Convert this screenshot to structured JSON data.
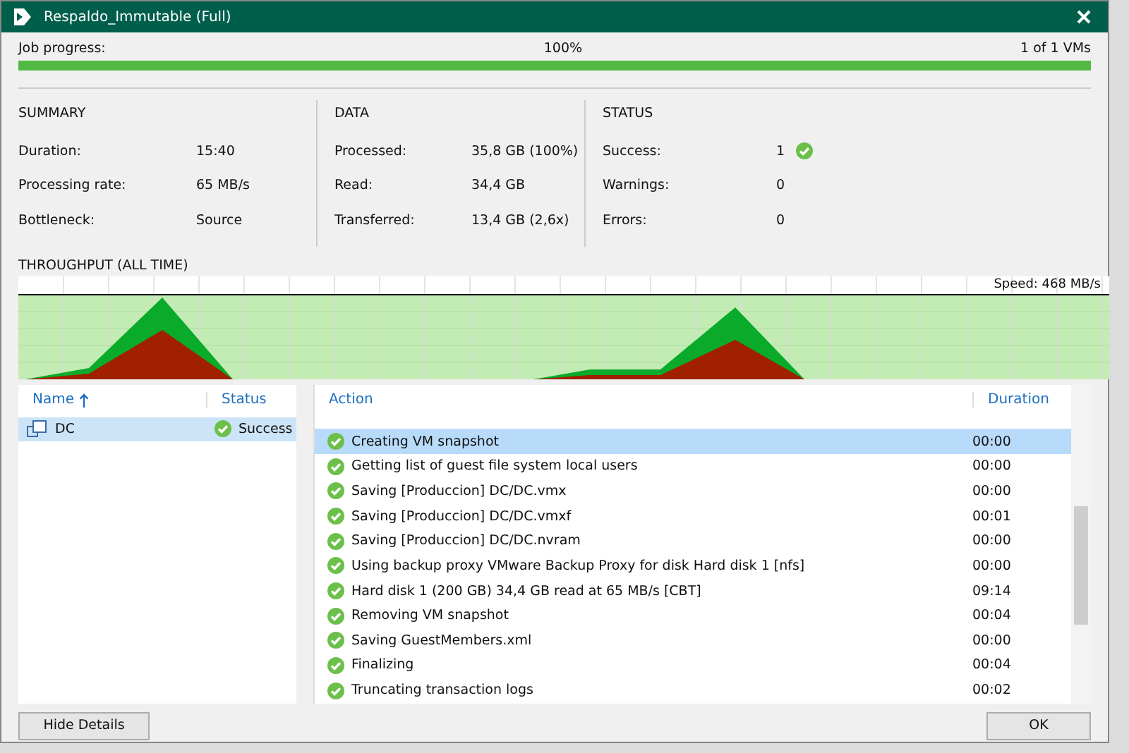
{
  "window": {
    "title": "Respaldo_Immutable (Full)"
  },
  "job_progress": {
    "label": "Job progress:",
    "percent": "100%",
    "count": "1 of 1 VMs",
    "level": 1
  },
  "summary": {
    "title": "SUMMARY",
    "rows": [
      {
        "label": "Duration:",
        "value": "15:40"
      },
      {
        "label": "Processing rate:",
        "value": "65 MB/s"
      },
      {
        "label": "Bottleneck:",
        "value": "Source"
      }
    ]
  },
  "data": {
    "title": "DATA",
    "rows": [
      {
        "label": "Processed:",
        "value": "35,8 GB (100%)"
      },
      {
        "label": "Read:",
        "value": "34,4 GB"
      },
      {
        "label": "Transferred:",
        "value": "13,4 GB (2,6x)"
      }
    ]
  },
  "status": {
    "title": "STATUS",
    "rows": [
      {
        "label": "Success:",
        "value": "1",
        "ok": true
      },
      {
        "label": "Warnings:",
        "value": "0",
        "ok": false
      },
      {
        "label": "Errors:",
        "value": "0",
        "ok": false
      }
    ]
  },
  "throughput": {
    "title": "THROUGHPUT (ALL TIME)",
    "speed": "Speed: 468 MB/s"
  },
  "vm_table": {
    "columns": [
      "Name",
      "Status"
    ],
    "rows": [
      {
        "name": "DC",
        "status": "Success",
        "selected": true
      }
    ]
  },
  "action_table": {
    "columns": [
      "Action",
      "Duration"
    ],
    "rows": [
      {
        "action": "Creating VM snapshot",
        "duration": "00:00",
        "selected": true
      },
      {
        "action": "Getting list of guest file system local users",
        "duration": "00:00",
        "selected": false
      },
      {
        "action": "Saving [Produccion] DC/DC.vmx",
        "duration": "00:00",
        "selected": false
      },
      {
        "action": "Saving [Produccion] DC/DC.vmxf",
        "duration": "00:01",
        "selected": false
      },
      {
        "action": "Saving [Produccion] DC/DC.nvram",
        "duration": "00:00",
        "selected": false
      },
      {
        "action": "Using backup proxy VMware Backup Proxy for disk Hard disk 1 [nfs]",
        "duration": "00:00",
        "selected": false
      },
      {
        "action": "Hard disk 1 (200 GB) 34,4 GB read at 65 MB/s [CBT]",
        "duration": "09:14",
        "selected": false
      },
      {
        "action": "Removing VM snapshot",
        "duration": "00:04",
        "selected": false
      },
      {
        "action": "Saving GuestMembers.xml",
        "duration": "00:00",
        "selected": false
      },
      {
        "action": "Finalizing",
        "duration": "00:04",
        "selected": false
      },
      {
        "action": "Truncating transaction logs",
        "duration": "00:02",
        "selected": false
      }
    ]
  },
  "buttons": {
    "left": "Hide Details",
    "right": "OK"
  }
}
